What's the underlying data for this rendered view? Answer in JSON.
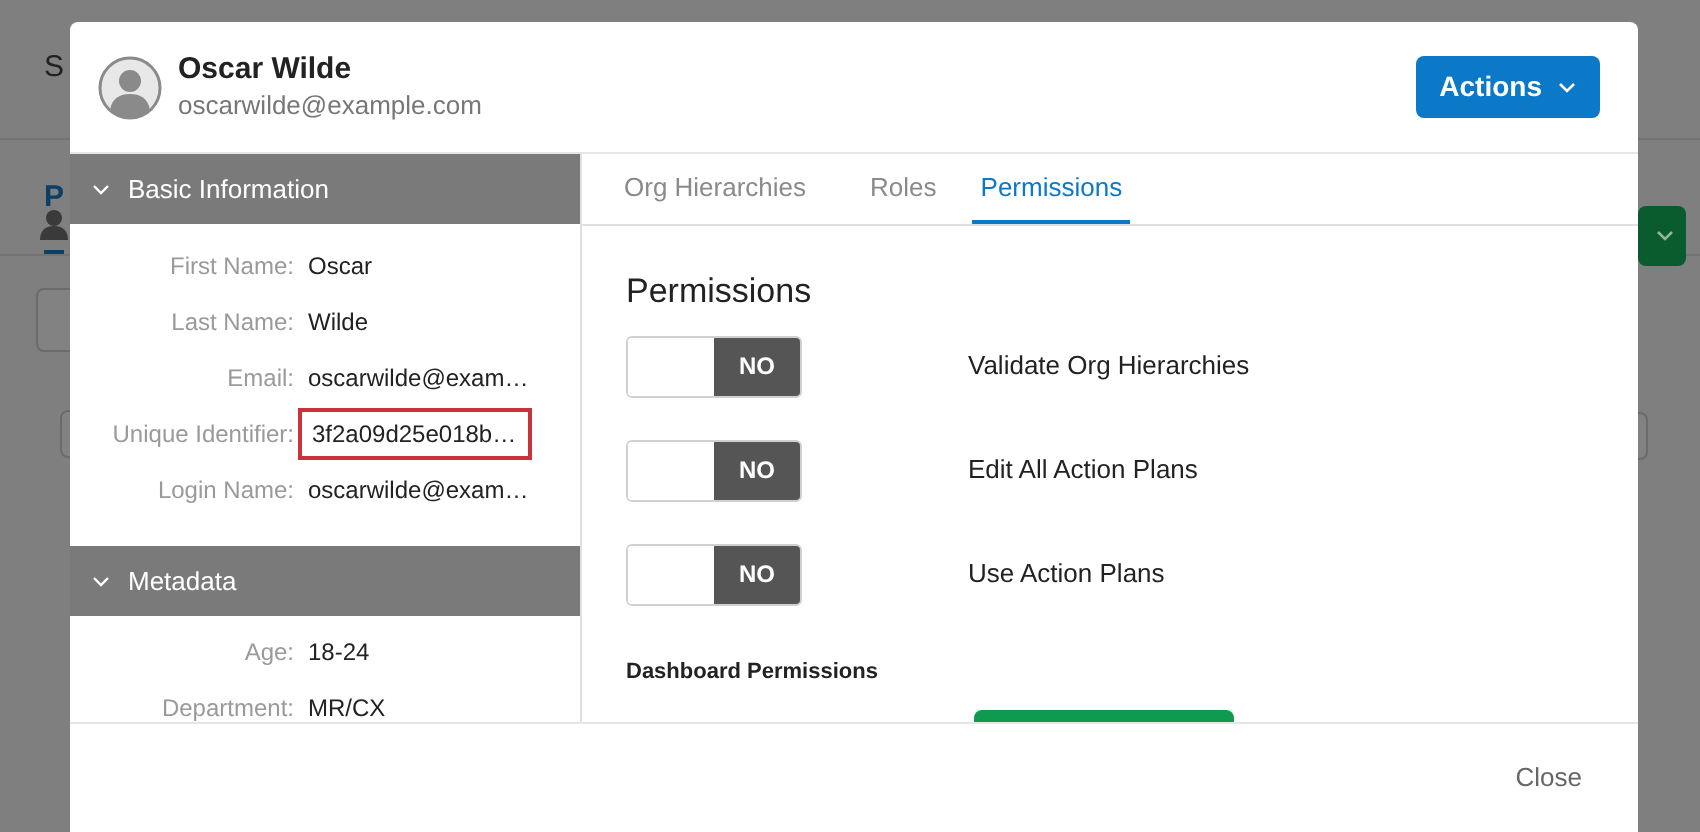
{
  "background": {
    "heading_fragment": "S",
    "tab_fragment": "P"
  },
  "dialog": {
    "name": "Oscar Wilde",
    "email": "oscarwilde@example.com",
    "actions_button": "Actions",
    "sections": [
      {
        "title": "Basic Information",
        "expanded": true,
        "fields": [
          {
            "label": "First Name:",
            "value": "Oscar",
            "highlighted": false
          },
          {
            "label": "Last Name:",
            "value": "Wilde",
            "highlighted": false
          },
          {
            "label": "Email:",
            "value": "oscarwilde@exam…",
            "highlighted": false
          },
          {
            "label": "Unique Identifier:",
            "value": "3f2a09d25e018b…",
            "highlighted": true
          },
          {
            "label": "Login Name:",
            "value": "oscarwilde@exam…",
            "highlighted": false
          }
        ]
      },
      {
        "title": "Metadata",
        "expanded": true,
        "fields": [
          {
            "label": "Age:",
            "value": "18-24",
            "highlighted": false
          },
          {
            "label": "Department:",
            "value": "MR/CX",
            "highlighted": false
          }
        ]
      }
    ],
    "tabs": [
      {
        "label": "Org Hierarchies",
        "selected": false
      },
      {
        "label": "Roles",
        "selected": false
      },
      {
        "label": "Permissions",
        "selected": true
      }
    ],
    "permissions_title": "Permissions",
    "permissions": [
      {
        "toggle_label": "NO",
        "on": false,
        "label": "Validate Org Hierarchies"
      },
      {
        "toggle_label": "NO",
        "on": false,
        "label": "Edit All Action Plans"
      },
      {
        "toggle_label": "NO",
        "on": false,
        "label": "Use Action Plans"
      }
    ],
    "dashboard_title": "Dashboard Permissions",
    "close_button": "Close"
  }
}
